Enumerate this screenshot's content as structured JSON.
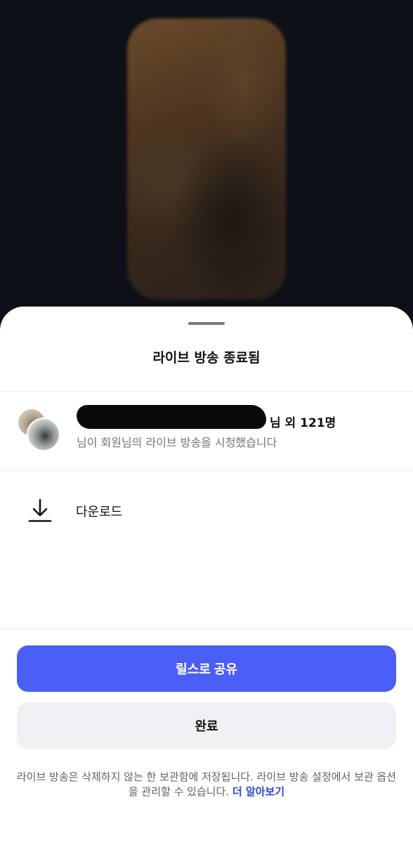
{
  "sheet": {
    "title": "라이브 방송 종료됨",
    "viewers": {
      "title_suffix": "님 외 121명",
      "subtitle": "님이 회원님의 라이브 방송을 시청했습니다"
    },
    "download": {
      "label": "다운로드",
      "icon": "download-icon"
    },
    "primary_button": "릴스로 공유",
    "secondary_button": "완료",
    "footnote_text": "라이브 방송은 삭제하지 않는 한 보관함에 저장됩니다. 라이브 방송 설정에서 보관 옵션을 관리할 수 있습니다.",
    "footnote_link": "더 알아보기"
  },
  "colors": {
    "primary": "#4b5ef5",
    "background": "#0d1117",
    "link": "#2f45d8"
  }
}
